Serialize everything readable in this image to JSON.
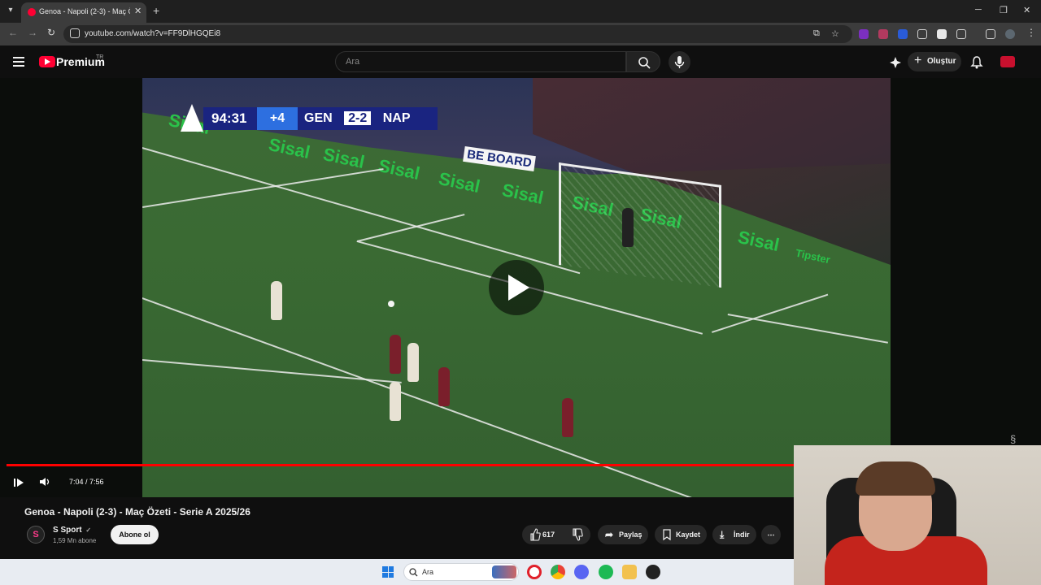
{
  "browser": {
    "tab_title": "Genoa - Napoli (2-3) - Maç Özeti",
    "url": "youtube.com/watch?v=FF9DlHGQEi8",
    "tab_close": "✕",
    "new_tab": "+",
    "win_min": "─",
    "win_max": "❐",
    "win_close": "✕"
  },
  "youtube": {
    "logo_text": "Premium",
    "region": "TR",
    "search_placeholder": "Ara",
    "create_label": "Oluştur",
    "create_plus": "+"
  },
  "video": {
    "score_clock": "94:31",
    "added_time": "+4",
    "home": "GEN",
    "score": "2-2",
    "away": "NAP",
    "ad_text": "Sisal",
    "ad_small": "Tipster",
    "be_board": "BE BOARD",
    "progress": 0.9,
    "time_display": "7:04 / 7:56"
  },
  "info": {
    "title": "Genoa - Napoli (2-3) - Maç Özeti - Serie A 2025/26",
    "channel_name": "S Sport",
    "channel_initial": "S",
    "verified": "✓",
    "subscribers": "1,59 Mn abone",
    "subscribe_label": "Abone ol",
    "likes": "617",
    "share_label": "Paylaş",
    "save_label": "Kaydet",
    "download_label": "İndir",
    "more_label": "⋯"
  },
  "taskbar": {
    "search_label": "Ara"
  },
  "colors": {
    "accent": "#ff0033",
    "progress": "#ff0000",
    "pitch": "#3a6a33"
  }
}
